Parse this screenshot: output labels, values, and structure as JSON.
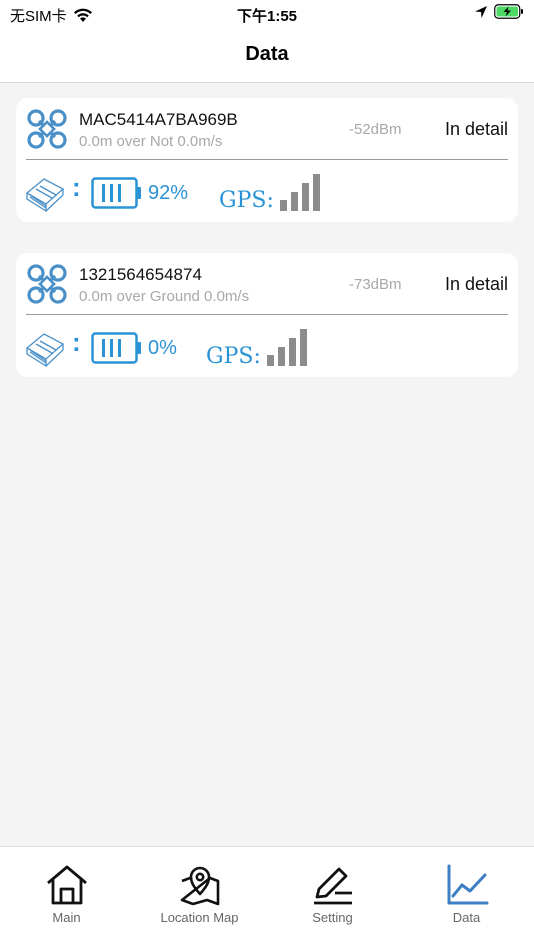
{
  "status_bar": {
    "carrier": "无SIM卡",
    "time": "下午1:55"
  },
  "header": {
    "title": "Data"
  },
  "devices": [
    {
      "name": "MAC5414A7BA969B",
      "status": "0.0m over Not 0.0m/s",
      "rssi": "-52dBm",
      "detail_label": "In detail",
      "battery_percent": "92%",
      "gps_label": "GPS:"
    },
    {
      "name": "1321564654874",
      "status": "0.0m over Ground 0.0m/s",
      "rssi": "-73dBm",
      "detail_label": "In detail",
      "battery_percent": "0%",
      "gps_label": "GPS:"
    }
  ],
  "tabs": [
    {
      "label": "Main",
      "icon": "home-icon"
    },
    {
      "label": "Location Map",
      "icon": "map-pin-icon"
    },
    {
      "label": "Setting",
      "icon": "edit-icon"
    },
    {
      "label": "Data",
      "icon": "chart-line-icon"
    }
  ],
  "colors": {
    "accent": "#2a93d5",
    "icon_blue": "#4a90c8",
    "signal_gray": "#8c8c8c",
    "active_tab": "#3d7fc4"
  }
}
